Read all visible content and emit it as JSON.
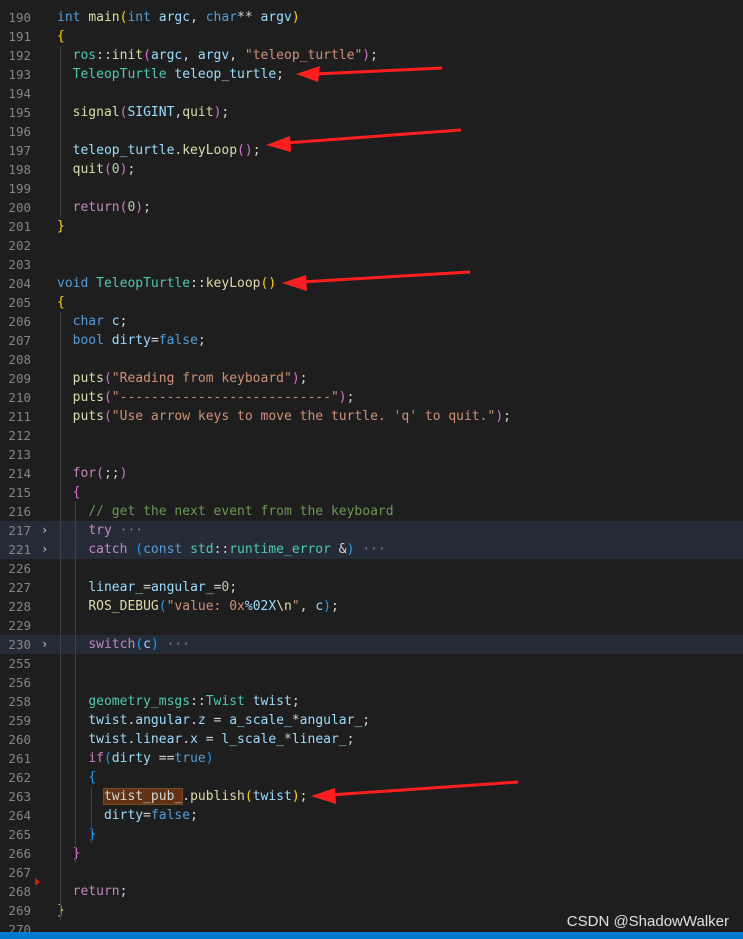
{
  "editor": {
    "lines": [
      {
        "n": "190",
        "tokens": [
          [
            "kw",
            "int"
          ],
          [
            "p",
            " "
          ],
          [
            "fn",
            "main"
          ],
          [
            "b1",
            "("
          ],
          [
            "kw",
            "int"
          ],
          [
            "p",
            " "
          ],
          [
            "vr",
            "argc"
          ],
          [
            "p",
            ", "
          ],
          [
            "kw",
            "char"
          ],
          [
            "p",
            "** "
          ],
          [
            "vr",
            "argv"
          ],
          [
            "b1",
            ")"
          ]
        ]
      },
      {
        "n": "191",
        "tokens": [
          [
            "b1",
            "{"
          ]
        ]
      },
      {
        "n": "192",
        "tokens": [
          [
            "p",
            "  "
          ],
          [
            "ty",
            "ros"
          ],
          [
            "p",
            "::"
          ],
          [
            "fn",
            "init"
          ],
          [
            "b2",
            "("
          ],
          [
            "vr",
            "argc"
          ],
          [
            "p",
            ", "
          ],
          [
            "vr",
            "argv"
          ],
          [
            "p",
            ", "
          ],
          [
            "st",
            "\"teleop_turtle\""
          ],
          [
            "b2",
            ")"
          ],
          [
            "p",
            ";"
          ]
        ]
      },
      {
        "n": "193",
        "tokens": [
          [
            "p",
            "  "
          ],
          [
            "ty",
            "TeleopTurtle"
          ],
          [
            "p",
            " "
          ],
          [
            "vr",
            "teleop_turtle"
          ],
          [
            "p",
            ";"
          ]
        ]
      },
      {
        "n": "194",
        "tokens": []
      },
      {
        "n": "195",
        "tokens": [
          [
            "p",
            "  "
          ],
          [
            "fn",
            "signal"
          ],
          [
            "b2",
            "("
          ],
          [
            "vr",
            "SIGINT"
          ],
          [
            "p",
            ","
          ],
          [
            "fn",
            "quit"
          ],
          [
            "b2",
            ")"
          ],
          [
            "p",
            ";"
          ]
        ]
      },
      {
        "n": "196",
        "tokens": []
      },
      {
        "n": "197",
        "tokens": [
          [
            "p",
            "  "
          ],
          [
            "vr",
            "teleop_turtle"
          ],
          [
            "p",
            "."
          ],
          [
            "fn",
            "keyLoop"
          ],
          [
            "b2",
            "()"
          ],
          [
            "p",
            ";"
          ]
        ]
      },
      {
        "n": "198",
        "tokens": [
          [
            "p",
            "  "
          ],
          [
            "fn",
            "quit"
          ],
          [
            "b2",
            "("
          ],
          [
            "nm",
            "0"
          ],
          [
            "b2",
            ")"
          ],
          [
            "p",
            ";"
          ]
        ]
      },
      {
        "n": "199",
        "tokens": []
      },
      {
        "n": "200",
        "tokens": [
          [
            "p",
            "  "
          ],
          [
            "cf",
            "return"
          ],
          [
            "b2",
            "("
          ],
          [
            "nm",
            "0"
          ],
          [
            "b2",
            ")"
          ],
          [
            "p",
            ";"
          ]
        ]
      },
      {
        "n": "201",
        "tokens": [
          [
            "b1",
            "}"
          ]
        ]
      },
      {
        "n": "202",
        "tokens": []
      },
      {
        "n": "203",
        "tokens": []
      },
      {
        "n": "204",
        "tokens": [
          [
            "kw",
            "void"
          ],
          [
            "p",
            " "
          ],
          [
            "ty",
            "TeleopTurtle"
          ],
          [
            "p",
            "::"
          ],
          [
            "fn",
            "keyLoop"
          ],
          [
            "b1",
            "()"
          ]
        ]
      },
      {
        "n": "205",
        "tokens": [
          [
            "b1",
            "{"
          ]
        ]
      },
      {
        "n": "206",
        "tokens": [
          [
            "p",
            "  "
          ],
          [
            "kw",
            "char"
          ],
          [
            "p",
            " "
          ],
          [
            "vr",
            "c"
          ],
          [
            "p",
            ";"
          ]
        ]
      },
      {
        "n": "207",
        "tokens": [
          [
            "p",
            "  "
          ],
          [
            "kw",
            "bool"
          ],
          [
            "p",
            " "
          ],
          [
            "vr",
            "dirty"
          ],
          [
            "p",
            "="
          ],
          [
            "kw",
            "false"
          ],
          [
            "p",
            ";"
          ]
        ]
      },
      {
        "n": "208",
        "tokens": []
      },
      {
        "n": "209",
        "tokens": [
          [
            "p",
            "  "
          ],
          [
            "fn",
            "puts"
          ],
          [
            "b2",
            "("
          ],
          [
            "st",
            "\"Reading from keyboard\""
          ],
          [
            "b2",
            ")"
          ],
          [
            "p",
            ";"
          ]
        ]
      },
      {
        "n": "210",
        "tokens": [
          [
            "p",
            "  "
          ],
          [
            "fn",
            "puts"
          ],
          [
            "b2",
            "("
          ],
          [
            "st",
            "\"---------------------------\""
          ],
          [
            "b2",
            ")"
          ],
          [
            "p",
            ";"
          ]
        ]
      },
      {
        "n": "211",
        "tokens": [
          [
            "p",
            "  "
          ],
          [
            "fn",
            "puts"
          ],
          [
            "b2",
            "("
          ],
          [
            "st",
            "\"Use arrow keys to move the turtle. 'q' to quit.\""
          ],
          [
            "b2",
            ")"
          ],
          [
            "p",
            ";"
          ]
        ]
      },
      {
        "n": "212",
        "tokens": []
      },
      {
        "n": "213",
        "tokens": []
      },
      {
        "n": "214",
        "tokens": [
          [
            "p",
            "  "
          ],
          [
            "cf",
            "for"
          ],
          [
            "b2",
            "("
          ],
          [
            "p",
            ";;"
          ],
          [
            "b2",
            ")"
          ]
        ]
      },
      {
        "n": "215",
        "tokens": [
          [
            "p",
            "  "
          ],
          [
            "b2",
            "{"
          ]
        ]
      },
      {
        "n": "216",
        "tokens": [
          [
            "p",
            "    "
          ],
          [
            "cm",
            "// get the next event from the keyboard"
          ]
        ]
      },
      {
        "n": "217",
        "fold": true,
        "hl": true,
        "tokens": [
          [
            "p",
            "    "
          ],
          [
            "cf",
            "try"
          ],
          [
            "el",
            " ···"
          ]
        ]
      },
      {
        "n": "221",
        "fold": true,
        "hl": true,
        "tokens": [
          [
            "p",
            "    "
          ],
          [
            "cf",
            "catch"
          ],
          [
            "p",
            " "
          ],
          [
            "b3",
            "("
          ],
          [
            "kw",
            "const"
          ],
          [
            "p",
            " "
          ],
          [
            "ty",
            "std"
          ],
          [
            "p",
            "::"
          ],
          [
            "ty",
            "runtime_error"
          ],
          [
            "p",
            " &"
          ],
          [
            "b3",
            ")"
          ],
          [
            "el",
            " ···"
          ]
        ]
      },
      {
        "n": "226",
        "tokens": []
      },
      {
        "n": "227",
        "tokens": [
          [
            "p",
            "    "
          ],
          [
            "vr",
            "linear_"
          ],
          [
            "p",
            "="
          ],
          [
            "vr",
            "angular_"
          ],
          [
            "p",
            "="
          ],
          [
            "nm",
            "0"
          ],
          [
            "p",
            ";"
          ]
        ]
      },
      {
        "n": "228",
        "tokens": [
          [
            "p",
            "    "
          ],
          [
            "fn",
            "ROS_DEBUG"
          ],
          [
            "b3",
            "("
          ],
          [
            "st",
            "\"value: 0x"
          ],
          [
            "vr",
            "%02X"
          ],
          [
            "fn",
            "\\n"
          ],
          [
            "st",
            "\""
          ],
          [
            "p",
            ", "
          ],
          [
            "vr",
            "c"
          ],
          [
            "b3",
            ")"
          ],
          [
            "p",
            ";"
          ]
        ]
      },
      {
        "n": "229",
        "tokens": []
      },
      {
        "n": "230",
        "fold": true,
        "hl": true,
        "tokens": [
          [
            "p",
            "    "
          ],
          [
            "cf",
            "switch"
          ],
          [
            "b3",
            "("
          ],
          [
            "vr",
            "c"
          ],
          [
            "b3",
            ")"
          ],
          [
            "el",
            " ···"
          ]
        ]
      },
      {
        "n": "255",
        "tokens": []
      },
      {
        "n": "256",
        "tokens": []
      },
      {
        "n": "258",
        "tokens": [
          [
            "p",
            "    "
          ],
          [
            "ty",
            "geometry_msgs"
          ],
          [
            "p",
            "::"
          ],
          [
            "ty",
            "Twist"
          ],
          [
            "p",
            " "
          ],
          [
            "vr",
            "twist"
          ],
          [
            "p",
            ";"
          ]
        ]
      },
      {
        "n": "259",
        "tokens": [
          [
            "p",
            "    "
          ],
          [
            "vr",
            "twist"
          ],
          [
            "p",
            "."
          ],
          [
            "vr",
            "angular"
          ],
          [
            "p",
            "."
          ],
          [
            "vr",
            "z"
          ],
          [
            "p",
            " = "
          ],
          [
            "vr",
            "a_scale_"
          ],
          [
            "p",
            "*"
          ],
          [
            "vr",
            "angular_"
          ],
          [
            "p",
            ";"
          ]
        ]
      },
      {
        "n": "260",
        "tokens": [
          [
            "p",
            "    "
          ],
          [
            "vr",
            "twist"
          ],
          [
            "p",
            "."
          ],
          [
            "vr",
            "linear"
          ],
          [
            "p",
            "."
          ],
          [
            "vr",
            "x"
          ],
          [
            "p",
            " = "
          ],
          [
            "vr",
            "l_scale_"
          ],
          [
            "p",
            "*"
          ],
          [
            "vr",
            "linear_"
          ],
          [
            "p",
            ";"
          ]
        ]
      },
      {
        "n": "261",
        "tokens": [
          [
            "p",
            "    "
          ],
          [
            "cf",
            "if"
          ],
          [
            "b3",
            "("
          ],
          [
            "vr",
            "dirty"
          ],
          [
            "p",
            " =="
          ],
          [
            "kw",
            "true"
          ],
          [
            "b3",
            ")"
          ]
        ]
      },
      {
        "n": "262",
        "tokens": [
          [
            "p",
            "    "
          ],
          [
            "b3",
            "{"
          ]
        ]
      },
      {
        "n": "263",
        "tokens": [
          [
            "p",
            "      "
          ],
          [
            "hlw",
            "twist_pub_"
          ],
          [
            "p",
            "."
          ],
          [
            "fn",
            "publish"
          ],
          [
            "b1",
            "("
          ],
          [
            "vr",
            "twist"
          ],
          [
            "b1",
            ")"
          ],
          [
            "p",
            ";"
          ]
        ]
      },
      {
        "n": "264",
        "tokens": [
          [
            "p",
            "      "
          ],
          [
            "vr",
            "dirty"
          ],
          [
            "p",
            "="
          ],
          [
            "kw",
            "false"
          ],
          [
            "p",
            ";"
          ]
        ]
      },
      {
        "n": "265",
        "tokens": [
          [
            "p",
            "    "
          ],
          [
            "b3",
            "}"
          ]
        ]
      },
      {
        "n": "266",
        "tokens": [
          [
            "p",
            "  "
          ],
          [
            "b2",
            "}"
          ]
        ]
      },
      {
        "n": "267",
        "tokens": []
      },
      {
        "n": "268",
        "tokens": [
          [
            "p",
            "  "
          ],
          [
            "cf",
            "return"
          ],
          [
            "p",
            ";"
          ]
        ]
      },
      {
        "n": "269",
        "tokens": [
          [
            "b1",
            "}"
          ]
        ]
      },
      {
        "n": "270",
        "tokens": []
      }
    ]
  },
  "watermark": "CSDN @ShadowWalker",
  "colors": {
    "background": "#1e1e1e",
    "statusbar": "#007acc",
    "arrow": "#ff1e1e"
  }
}
